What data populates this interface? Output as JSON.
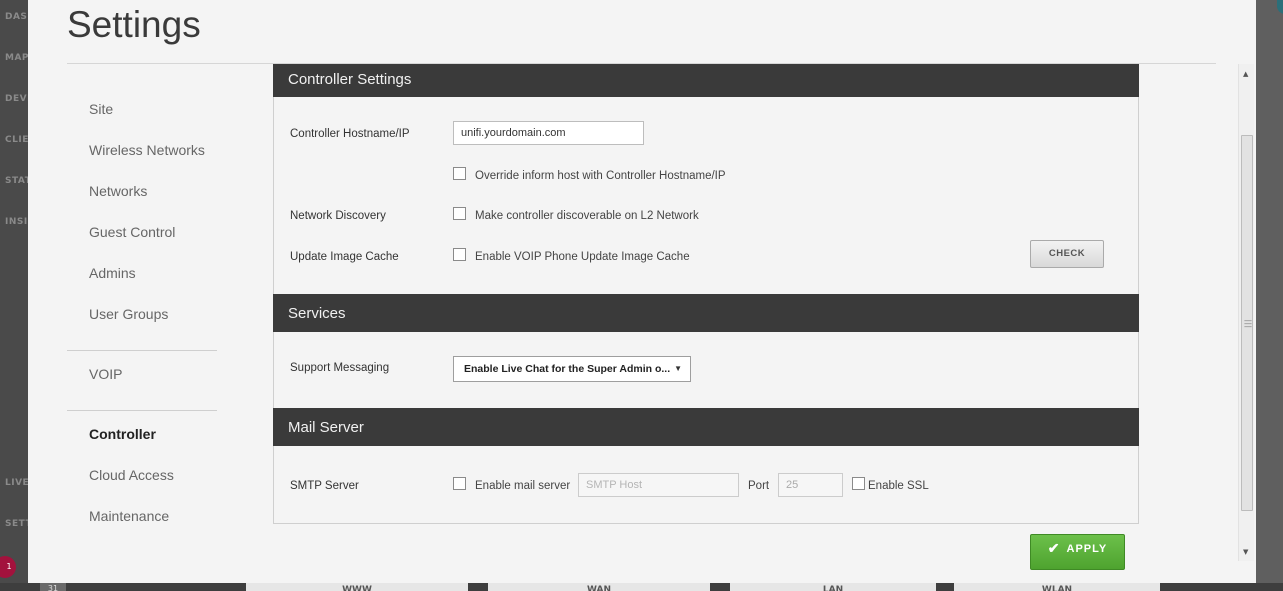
{
  "background": {
    "left_nav_labels": [
      "DASH",
      "MAP",
      "DEVI",
      "CLIE",
      "STAT",
      "INSI",
      "LIVE",
      "SETT"
    ],
    "badge_count": "1",
    "bottom_chip": "31",
    "bottom_tabs": [
      "WWW",
      "WAN",
      "LAN",
      "WLAN"
    ]
  },
  "modal": {
    "title": "Settings"
  },
  "nav": {
    "items": [
      {
        "label": "Site"
      },
      {
        "label": "Wireless Networks"
      },
      {
        "label": "Networks"
      },
      {
        "label": "Guest Control"
      },
      {
        "label": "Admins"
      },
      {
        "label": "User Groups"
      },
      {
        "label": "VOIP"
      },
      {
        "label": "Controller"
      },
      {
        "label": "Cloud Access"
      },
      {
        "label": "Maintenance"
      }
    ],
    "active": "Controller"
  },
  "controller_settings": {
    "header": "Controller Settings",
    "hostname_label": "Controller Hostname/IP",
    "hostname_value": "unifi.yourdomain.com",
    "override_label": "Override inform host with Controller Hostname/IP",
    "override_checked": false,
    "discovery_label": "Network Discovery",
    "discovery_option": "Make controller discoverable on L2 Network",
    "discovery_checked": false,
    "image_cache_label": "Update Image Cache",
    "image_cache_option": "Enable VOIP Phone Update Image Cache",
    "image_cache_checked": false,
    "check_button": "CHECK"
  },
  "services": {
    "header": "Services",
    "support_label": "Support Messaging",
    "support_value": "Enable Live Chat for the Super Admin o..."
  },
  "mail_server": {
    "header": "Mail Server",
    "smtp_label": "SMTP Server",
    "enable_label": "Enable mail server",
    "enable_checked": false,
    "host_placeholder": "SMTP Host",
    "port_label": "Port",
    "port_value": "25",
    "ssl_label": "Enable SSL",
    "ssl_checked": false
  },
  "actions": {
    "apply": "APPLY"
  },
  "colors": {
    "section_header_bg": "#3a3a3a",
    "apply_green": "#5cb13b",
    "badge": "#a3123d"
  }
}
